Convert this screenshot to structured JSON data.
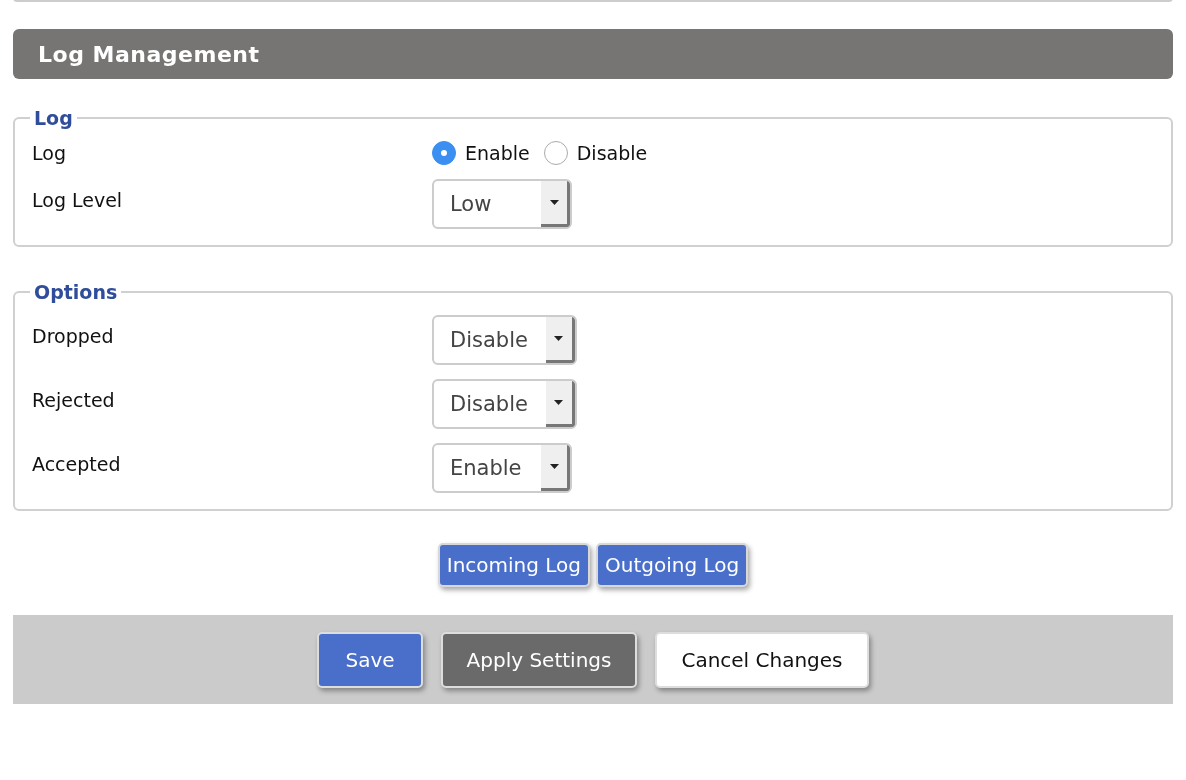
{
  "header": {
    "title": "Log Management"
  },
  "sections": [
    {
      "legend": "Log",
      "rows": [
        {
          "kind": "radio",
          "label": "Log",
          "options": [
            {
              "label": "Enable",
              "selected": true
            },
            {
              "label": "Disable",
              "selected": false
            }
          ]
        },
        {
          "kind": "select",
          "label": "Log Level",
          "value": "Low"
        }
      ]
    },
    {
      "legend": "Options",
      "rows": [
        {
          "kind": "select",
          "label": "Dropped",
          "value": "Disable"
        },
        {
          "kind": "select",
          "label": "Rejected",
          "value": "Disable"
        },
        {
          "kind": "select",
          "label": "Accepted",
          "value": "Enable"
        }
      ]
    }
  ],
  "log_buttons": [
    "Incoming Log",
    "Outgoing Log"
  ],
  "footer_buttons": [
    {
      "label": "Save",
      "kind": "primary"
    },
    {
      "label": "Apply Settings",
      "kind": "dark"
    },
    {
      "label": "Cancel Changes",
      "kind": "light"
    }
  ]
}
